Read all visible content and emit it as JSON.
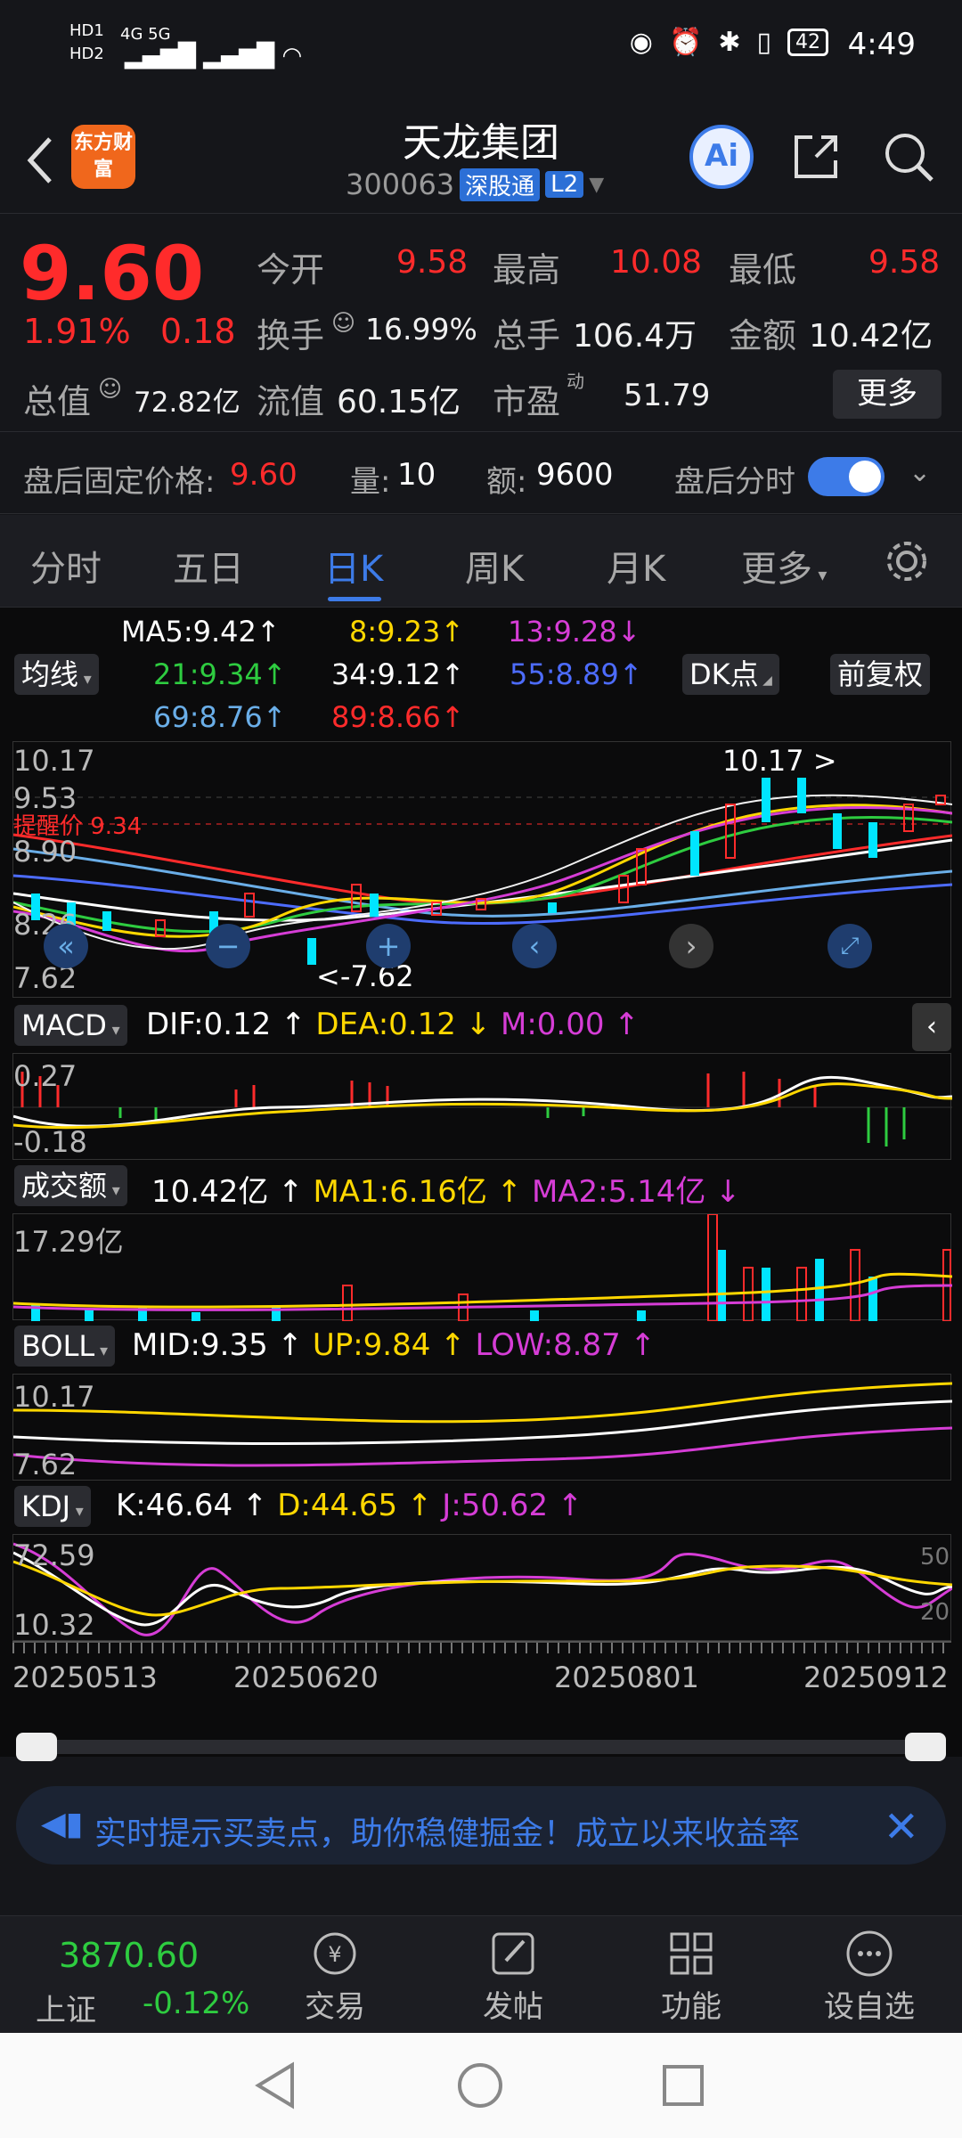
{
  "status": {
    "hd1": "HD1",
    "hd2": "HD2",
    "net1": "4G",
    "net2": "5G",
    "battery": "42",
    "time": "4:49"
  },
  "header": {
    "logo": "东方财富",
    "name": "天龙集团",
    "code": "300063",
    "tag1": "深股通",
    "tag2": "L2",
    "ai_label": "Ai"
  },
  "quote": {
    "price": "9.60",
    "change_pct": "1.91%",
    "change": "0.18",
    "open_label": "今开",
    "open": "9.58",
    "high_label": "最高",
    "high": "10.08",
    "low_label": "最低",
    "low": "9.58",
    "turnover_label": "换手",
    "turnover": "16.99%",
    "volume_label": "总手",
    "volume": "106.4万",
    "amount_label": "金额",
    "amount": "10.42亿",
    "mktcap_label": "总值",
    "mktcap": "72.82亿",
    "float_label": "流值",
    "float": "60.15亿",
    "pe_label": "市盈",
    "pe_sup": "动",
    "pe": "51.79",
    "more": "更多"
  },
  "afterhours": {
    "price_label": "盘后固定价格:",
    "price": "9.60",
    "vol_label": "量:",
    "vol": "10",
    "amt_label": "额:",
    "amt": "9600",
    "toggle_label": "盘后分时"
  },
  "tabs": [
    "分时",
    "五日",
    "日K",
    "周K",
    "月K",
    "更多"
  ],
  "kline": {
    "ma_select": "均线",
    "dk_select": "DK点",
    "adj_select": "前复权",
    "ma": [
      {
        "label": "MA5:9.42",
        "color": "#ffffff"
      },
      {
        "label": "8:9.23",
        "color": "#ffd700"
      },
      {
        "label": "13:9.28",
        "color": "#d63dd6"
      },
      {
        "label": "21:9.34",
        "color": "#2ecc40"
      },
      {
        "label": "34:9.12",
        "color": "#ffffff"
      },
      {
        "label": "55:8.89",
        "color": "#4d6cff"
      },
      {
        "label": "69:8.76",
        "color": "#6aaee8"
      },
      {
        "label": "89:8.66",
        "color": "#ff2b2b"
      }
    ],
    "arrows": [
      "↑",
      "↑",
      "↓",
      "↑",
      "↑",
      "↑",
      "↑",
      "↑"
    ],
    "y_top": "10.17",
    "y2": "9.53",
    "y3": "8.90",
    "y4": "8.26",
    "y_bot": "7.62",
    "alert": "提醒价 9.34",
    "max_label": "10.17 >",
    "min_label": "<-7.62"
  },
  "macd": {
    "select": "MACD",
    "dif": "DIF:0.12",
    "dea": "DEA:0.12",
    "m": "M:0.00",
    "y_top": "0.27",
    "y_bot": "-0.18"
  },
  "vol": {
    "select": "成交额",
    "val": "10.42亿",
    "ma1": "MA1:6.16亿",
    "ma2": "MA2:5.14亿",
    "y_top": "17.29亿"
  },
  "boll": {
    "select": "BOLL",
    "mid": "MID:9.35",
    "up": "UP:9.84",
    "low": "LOW:8.87",
    "y_top": "10.17",
    "y_bot": "7.62"
  },
  "kdj": {
    "select": "KDJ",
    "k": "K:46.64",
    "d": "D:44.65",
    "j": "J:50.62",
    "y_top": "72.59",
    "y_bot": "10.32",
    "r50": "50",
    "r20": "20"
  },
  "dates": [
    "20250513",
    "20250620",
    "20250801",
    "20250912"
  ],
  "banner": {
    "text": "实时提示买卖点，助你稳健掘金！成立以来收益率"
  },
  "index": {
    "value": "3870.60",
    "name": "上证",
    "change": "-0.12%"
  },
  "bottomnav": [
    "交易",
    "发帖",
    "功能",
    "设自选"
  ],
  "colors": {
    "up": "#ff2b2b",
    "down": "#00e5ff",
    "accent": "#3d7be8"
  }
}
